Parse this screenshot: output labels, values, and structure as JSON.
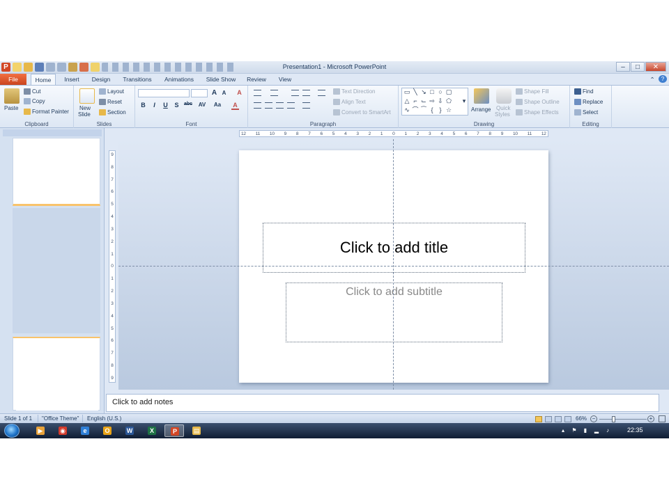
{
  "window": {
    "title": "Presentation1 - Microsoft PowerPoint",
    "app_icon_letter": "P",
    "minimize": "–",
    "maximize": "□",
    "close": "✕"
  },
  "tabs": [
    "File",
    "Home",
    "Insert",
    "Design",
    "Transitions",
    "Animations",
    "Slide Show",
    "Review",
    "View"
  ],
  "ribbon": {
    "clipboard": {
      "paste": "Paste",
      "cut": "Cut",
      "copy": "Copy",
      "format_painter": "Format Painter",
      "label": "Clipboard"
    },
    "slides": {
      "new_slide_line1": "New",
      "new_slide_line2": "Slide",
      "layout": "Layout",
      "reset": "Reset",
      "section": "Section",
      "label": "Slides"
    },
    "font": {
      "bold": "B",
      "italic": "I",
      "underline": "U",
      "strike": "S",
      "shadow": "abc",
      "spacing": "AV",
      "case": "Aa",
      "color": "A",
      "grow": "A",
      "shrink": "A",
      "clear": "A",
      "label": "Font"
    },
    "paragraph": {
      "text_direction": "Text Direction",
      "align_text": "Align Text",
      "convert_smartart": "Convert to SmartArt",
      "label": "Paragraph"
    },
    "drawing": {
      "arrange": "Arrange",
      "quick_styles_line1": "Quick",
      "quick_styles_line2": "Styles",
      "shape_fill": "Shape Fill",
      "shape_outline": "Shape Outline",
      "shape_effects": "Shape Effects",
      "label": "Drawing"
    },
    "editing": {
      "find": "Find",
      "replace": "Replace",
      "select": "Select",
      "label": "Editing"
    }
  },
  "rulers": {
    "horizontal": [
      "12",
      "11",
      "10",
      "9",
      "8",
      "7",
      "6",
      "5",
      "4",
      "3",
      "2",
      "1",
      "0",
      "1",
      "2",
      "3",
      "4",
      "5",
      "6",
      "7",
      "8",
      "9",
      "10",
      "11",
      "12"
    ],
    "vertical": [
      "9",
      "8",
      "7",
      "6",
      "5",
      "4",
      "3",
      "2",
      "1",
      "0",
      "1",
      "2",
      "3",
      "4",
      "5",
      "6",
      "7",
      "8",
      "9"
    ]
  },
  "slide": {
    "title_placeholder": "Click to add title",
    "subtitle_placeholder": "Click to add subtitle"
  },
  "notes": {
    "placeholder": "Click to add notes"
  },
  "statusbar": {
    "slide_count": "Slide 1 of 1",
    "theme": "\"Office Theme\"",
    "language": "English (U.S.)",
    "zoom": "66%"
  },
  "taskbar": {
    "time": "22:35",
    "apps": [
      {
        "name": "media-player",
        "letter": "▶",
        "color": "#e8a23a"
      },
      {
        "name": "chrome",
        "letter": "◉",
        "color": "#d33b2c"
      },
      {
        "name": "internet-explorer",
        "letter": "e",
        "color": "#2f7fd6"
      },
      {
        "name": "outlook",
        "letter": "O",
        "color": "#e8a317"
      },
      {
        "name": "word",
        "letter": "W",
        "color": "#2b5797"
      },
      {
        "name": "excel",
        "letter": "X",
        "color": "#1e7145"
      },
      {
        "name": "powerpoint",
        "letter": "P",
        "color": "#d24726"
      },
      {
        "name": "explorer",
        "letter": "▤",
        "color": "#e5b84b"
      }
    ]
  },
  "colors": {
    "accent_file_tab": "#d24726",
    "ribbon_bg": "#dfe8f5",
    "taskbar": "#1a2a44"
  }
}
